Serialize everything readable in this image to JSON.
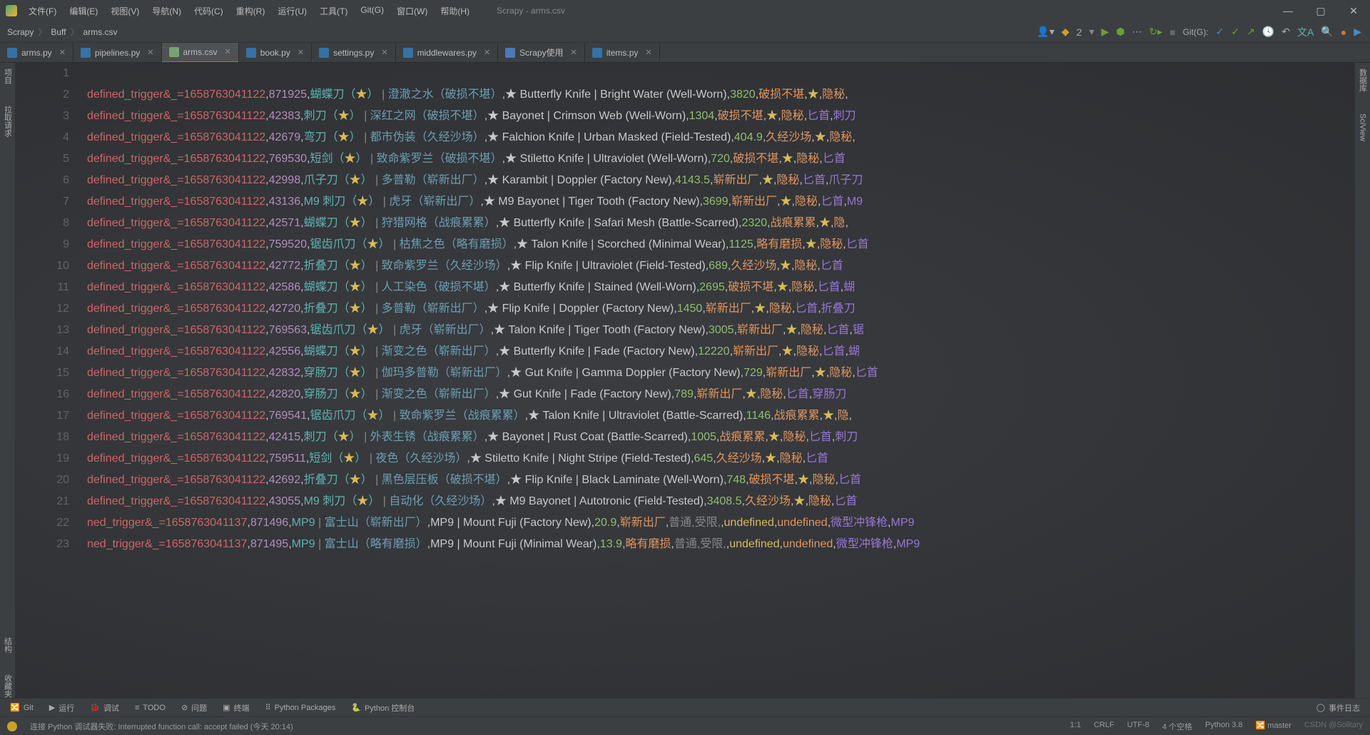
{
  "window": {
    "title": "Scrapy - arms.csv"
  },
  "menus": [
    "文件(F)",
    "编辑(E)",
    "视图(V)",
    "导航(N)",
    "代码(C)",
    "重构(R)",
    "运行(U)",
    "工具(T)",
    "Git(G)",
    "窗口(W)",
    "帮助(H)"
  ],
  "breadcrumb": [
    "Scrapy",
    "Buff",
    "arms.csv"
  ],
  "runconfig": {
    "icon": "python",
    "label": "2"
  },
  "git_label": "Git(G):",
  "tabs": [
    {
      "name": "arms.py",
      "type": "py"
    },
    {
      "name": "pipelines.py",
      "type": "py"
    },
    {
      "name": "arms.csv",
      "type": "csv",
      "active": true
    },
    {
      "name": "book.py",
      "type": "py"
    },
    {
      "name": "settings.py",
      "type": "py"
    },
    {
      "name": "middlewares.py",
      "type": "py"
    },
    {
      "name": "Scrapy使用",
      "type": "md"
    },
    {
      "name": "items.py",
      "type": "py"
    }
  ],
  "left_strip": [
    "项目",
    "拉取请求"
  ],
  "left_strip_bottom": [
    "结构",
    "收藏夹"
  ],
  "right_strip": [
    "数据库",
    "SciView"
  ],
  "csv_rows": [
    {
      "n": 1,
      "blank": true
    },
    {
      "n": 2,
      "trig": "defined_trigger&_=1658763041122",
      "id": "871925",
      "cn1": "蝴蝶刀（★）",
      "cn2": "澄澈之水（破损不堪）",
      "en": "★ Butterfly Knife | Bright Water (Well-Worn)",
      "price": "3820",
      "wear": "破损不堪",
      "t1": "★",
      "t2": "隐秘"
    },
    {
      "n": 3,
      "trig": "defined_trigger&_=1658763041122",
      "id": "42383",
      "cn1": "刺刀（★）",
      "cn2": "深红之网（破损不堪）",
      "en": "★ Bayonet | Crimson Web (Well-Worn)",
      "price": "1304",
      "wear": "破损不堪",
      "t1": "★",
      "t2": "隐秘",
      "trail": "匕首,刺刀"
    },
    {
      "n": 4,
      "trig": "defined_trigger&_=1658763041122",
      "id": "42679",
      "cn1": "弯刀（★）",
      "cn2": "都市伪装（久经沙场）",
      "en": "★ Falchion Knife | Urban Masked (Field-Tested)",
      "price": "404.9",
      "wear": "久经沙场",
      "t1": "★",
      "t2": "隐秘"
    },
    {
      "n": 5,
      "trig": "defined_trigger&_=1658763041122",
      "id": "769530",
      "cn1": "短剑（★）",
      "cn2": "致命紫罗兰（破损不堪）",
      "en": "★ Stiletto Knife | Ultraviolet (Well-Worn)",
      "price": "720",
      "wear": "破损不堪",
      "t1": "★",
      "t2": "隐秘",
      "trail": "匕首"
    },
    {
      "n": 6,
      "trig": "defined_trigger&_=1658763041122",
      "id": "42998",
      "cn1": "爪子刀（★）",
      "cn2": "多普勒（崭新出厂）",
      "en": "★ Karambit | Doppler (Factory New)",
      "price": "4143.5",
      "wear": "崭新出厂",
      "t1": "★",
      "t2": "隐秘",
      "trail": "匕首,爪子刀"
    },
    {
      "n": 7,
      "trig": "defined_trigger&_=1658763041122",
      "id": "43136",
      "cn1": "M9 刺刀（★）",
      "cn2": "虎牙（崭新出厂）",
      "en": "★ M9 Bayonet | Tiger Tooth (Factory New)",
      "price": "3699",
      "wear": "崭新出厂",
      "t1": "★",
      "t2": "隐秘",
      "trail": "匕首,M9"
    },
    {
      "n": 8,
      "trig": "defined_trigger&_=1658763041122",
      "id": "42571",
      "cn1": "蝴蝶刀（★）",
      "cn2": "狩猎网格（战痕累累）",
      "en": "★ Butterfly Knife | Safari Mesh (Battle-Scarred)",
      "price": "2320",
      "wear": "战痕累累",
      "t1": "★",
      "t2": "隐"
    },
    {
      "n": 9,
      "trig": "defined_trigger&_=1658763041122",
      "id": "759520",
      "cn1": "锯齿爪刀（★）",
      "cn2": "枯焦之色（略有磨损）",
      "en": "★ Talon Knife | Scorched (Minimal Wear)",
      "price": "1125",
      "wear": "略有磨损",
      "t1": "★",
      "t2": "隐秘",
      "trail": "匕首"
    },
    {
      "n": 10,
      "trig": "defined_trigger&_=1658763041122",
      "id": "42772",
      "cn1": "折叠刀（★）",
      "cn2": "致命紫罗兰（久经沙场）",
      "en": "★ Flip Knife | Ultraviolet (Field-Tested)",
      "price": "689",
      "wear": "久经沙场",
      "t1": "★",
      "t2": "隐秘",
      "trail": "匕首"
    },
    {
      "n": 11,
      "trig": "defined_trigger&_=1658763041122",
      "id": "42586",
      "cn1": "蝴蝶刀（★）",
      "cn2": "人工染色（破损不堪）",
      "en": "★ Butterfly Knife | Stained (Well-Worn)",
      "price": "2695",
      "wear": "破损不堪",
      "t1": "★",
      "t2": "隐秘",
      "trail": "匕首,蝴"
    },
    {
      "n": 12,
      "trig": "defined_trigger&_=1658763041122",
      "id": "42720",
      "cn1": "折叠刀（★）",
      "cn2": "多普勒（崭新出厂）",
      "en": "★ Flip Knife | Doppler (Factory New)",
      "price": "1450",
      "wear": "崭新出厂",
      "t1": "★",
      "t2": "隐秘",
      "trail": "匕首,折叠刀"
    },
    {
      "n": 13,
      "trig": "defined_trigger&_=1658763041122",
      "id": "769563",
      "cn1": "锯齿爪刀（★）",
      "cn2": "虎牙（崭新出厂）",
      "en": "★ Talon Knife | Tiger Tooth (Factory New)",
      "price": "3005",
      "wear": "崭新出厂",
      "t1": "★",
      "t2": "隐秘",
      "trail": "匕首,锯"
    },
    {
      "n": 14,
      "trig": "defined_trigger&_=1658763041122",
      "id": "42556",
      "cn1": "蝴蝶刀（★）",
      "cn2": "渐变之色（崭新出厂）",
      "en": "★ Butterfly Knife | Fade (Factory New)",
      "price": "12220",
      "wear": "崭新出厂",
      "t1": "★",
      "t2": "隐秘",
      "trail": "匕首,蝴"
    },
    {
      "n": 15,
      "trig": "defined_trigger&_=1658763041122",
      "id": "42832",
      "cn1": "穿肠刀（★）",
      "cn2": "伽玛多普勒（崭新出厂）",
      "en": "★ Gut Knife | Gamma Doppler (Factory New)",
      "price": "729",
      "wear": "崭新出厂",
      "t1": "★",
      "t2": "隐秘",
      "trail": "匕首"
    },
    {
      "n": 16,
      "trig": "defined_trigger&_=1658763041122",
      "id": "42820",
      "cn1": "穿肠刀（★）",
      "cn2": "渐变之色（崭新出厂）",
      "en": "★ Gut Knife | Fade (Factory New)",
      "price": "789",
      "wear": "崭新出厂",
      "t1": "★",
      "t2": "隐秘",
      "trail": "匕首,穿肠刀"
    },
    {
      "n": 17,
      "trig": "defined_trigger&_=1658763041122",
      "id": "769541",
      "cn1": "锯齿爪刀（★）",
      "cn2": "致命紫罗兰（战痕累累）",
      "en": "★ Talon Knife | Ultraviolet (Battle-Scarred)",
      "price": "1146",
      "wear": "战痕累累",
      "t1": "★",
      "t2": "隐"
    },
    {
      "n": 18,
      "trig": "defined_trigger&_=1658763041122",
      "id": "42415",
      "cn1": "刺刀（★）",
      "cn2": "外表生锈（战痕累累）",
      "en": "★ Bayonet | Rust Coat (Battle-Scarred)",
      "price": "1005",
      "wear": "战痕累累",
      "t1": "★",
      "t2": "隐秘",
      "trail": "匕首,刺刀"
    },
    {
      "n": 19,
      "trig": "defined_trigger&_=1658763041122",
      "id": "759511",
      "cn1": "短剑（★）",
      "cn2": "夜色（久经沙场）",
      "en": "★ Stiletto Knife | Night Stripe (Field-Tested)",
      "price": "645",
      "wear": "久经沙场",
      "t1": "★",
      "t2": "隐秘",
      "trail": "匕首"
    },
    {
      "n": 20,
      "trig": "defined_trigger&_=1658763041122",
      "id": "42692",
      "cn1": "折叠刀（★）",
      "cn2": "黑色层压板（破损不堪）",
      "en": "★ Flip Knife | Black Laminate (Well-Worn)",
      "price": "748",
      "wear": "破损不堪",
      "t1": "★",
      "t2": "隐秘",
      "trail": "匕首"
    },
    {
      "n": 21,
      "trig": "defined_trigger&_=1658763041122",
      "id": "43055",
      "cn1": "M9 刺刀（★）",
      "cn2": "自动化（久经沙场）",
      "en": "★ M9 Bayonet | Autotronic (Field-Tested)",
      "price": "3408.5",
      "wear": "久经沙场",
      "t1": "★",
      "t2": "隐秘",
      "trail": "匕首"
    },
    {
      "n": 22,
      "trig": "ned_trigger&_=1658763041137",
      "id": "871496",
      "cn1": "MP9",
      "cn2": "富士山（崭新出厂）",
      "en": "MP9 | Mount Fuji (Factory New)",
      "price": "20.9",
      "wear": "崭新出厂",
      "xtra": "普通,受限,",
      "trail": "微型冲锋枪,MP9"
    },
    {
      "n": 23,
      "trig": "ned_trigger&_=1658763041137",
      "id": "871495",
      "cn1": "MP9",
      "cn2": "富士山（略有磨损）",
      "en": "MP9 | Mount Fuji (Minimal Wear)",
      "price": "13.9",
      "wear": "略有磨损",
      "xtra": "普通,受限,",
      "trail": "微型冲锋枪,MP9"
    }
  ],
  "toolwin": {
    "git": "Git",
    "run": "运行",
    "debug": "调试",
    "todo": "TODO",
    "problems": "问题",
    "terminal": "终端",
    "pkgs": "Python Packages",
    "console": "Python 控制台",
    "events": "事件日志"
  },
  "status": {
    "msg": "连接 Python 调试器失败: Interrupted function call: accept failed (今天 20:14)",
    "pos": "1:1",
    "eol": "CRLF",
    "enc": "UTF-8",
    "indent": "4 个空格",
    "interp": "Python 3.8",
    "branch": "master",
    "watermark": "CSDN @Solitary"
  }
}
